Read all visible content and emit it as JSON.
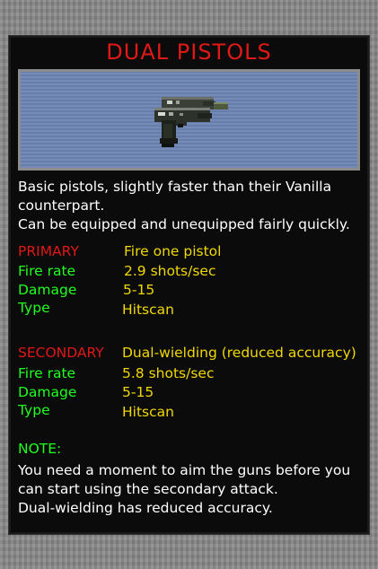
{
  "title": "DUAL PISTOLS",
  "weapon_icon": "dual-pistols-sprite",
  "description": [
    "Basic pistols, slightly faster than their Vanilla",
    "counterpart.",
    "Can be equipped and unequipped fairly quickly."
  ],
  "primary": {
    "header": "PRIMARY",
    "mode": "Fire one pistol",
    "fire_rate_label": "Fire rate",
    "fire_rate": "2.9 shots/sec",
    "damage_label": "Damage",
    "damage": "5-15",
    "type_label": "Type",
    "type": "Hitscan"
  },
  "secondary": {
    "header": "SECONDARY",
    "mode": "Dual-wielding (reduced accuracy)",
    "fire_rate_label": "Fire rate",
    "fire_rate": "5.8 shots/sec",
    "damage_label": "Damage",
    "damage": "5-15",
    "type_label": "Type",
    "type": "Hitscan"
  },
  "note": {
    "header": "NOTE:",
    "lines": [
      "You need a moment to aim the guns before you",
      "can start using the secondary attack.",
      "Dual-wielding has reduced accuracy."
    ]
  },
  "colors": {
    "title_red": "#e01818",
    "label_green": "#20ff20",
    "value_yellow": "#f0d800",
    "panel_bg": "#0b0b0b",
    "preview_bg": "#6d84b3"
  }
}
